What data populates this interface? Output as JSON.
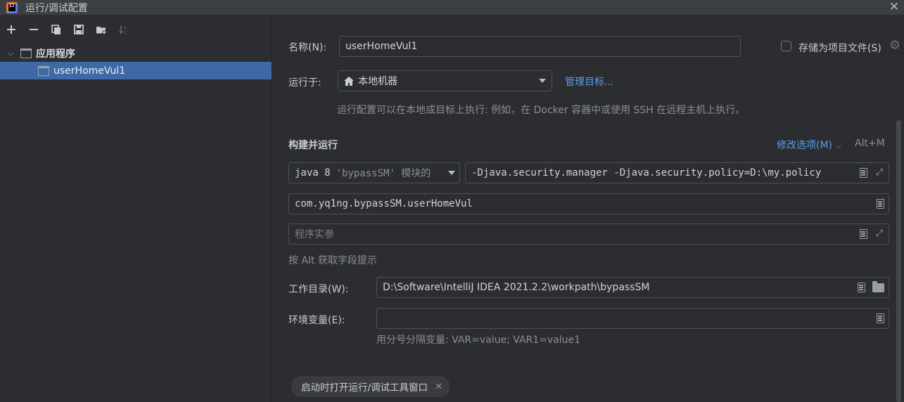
{
  "window": {
    "title": "运行/调试配置"
  },
  "toolbar": {
    "buttons": [
      "add-icon",
      "remove-icon",
      "copy-icon",
      "save-icon",
      "new-folder-icon",
      "sort-icon"
    ]
  },
  "tree": {
    "group_label": "应用程序",
    "item_label": "userHomeVul1"
  },
  "form": {
    "name_label": "名称(N):",
    "name_value": "userHomeVul1",
    "store_as_project_file": "存储为项目文件(S)",
    "run_on_label": "运行于:",
    "run_on_value": "本地机器",
    "manage_targets": "管理目标...",
    "run_on_hint": "运行配置可以在本地或目标上执行: 例如，在 Docker 容器中或使用 SSH 在远程主机上执行。",
    "build_run_label": "构建并运行",
    "modify_options": "修改选项(M)",
    "modify_options_shortcut": "Alt+M",
    "jre_prefix": "java 8",
    "jre_module": "'bypassSM' 模块的",
    "vm_options": "-Djava.security.manager -Djava.security.policy=D:\\my.policy",
    "main_class": "com.yq1ng.bypassSM.userHomeVul",
    "program_args_placeholder": "程序实参",
    "alt_hint": "按 Alt 获取字段提示",
    "workdir_label": "工作目录(W):",
    "workdir_value": "D:\\Software\\IntelliJ IDEA 2021.2.2\\workpath\\bypassSM",
    "env_label": "环境变量(E):",
    "env_value": "",
    "env_hint": "用分号分隔变量: VAR=value; VAR1=value1",
    "chip_label": "启动时打开运行/调试工具窗口"
  },
  "colors": {
    "accent": "#3d6aa6",
    "link": "#5a9ef0",
    "background": "#2b2d30"
  }
}
